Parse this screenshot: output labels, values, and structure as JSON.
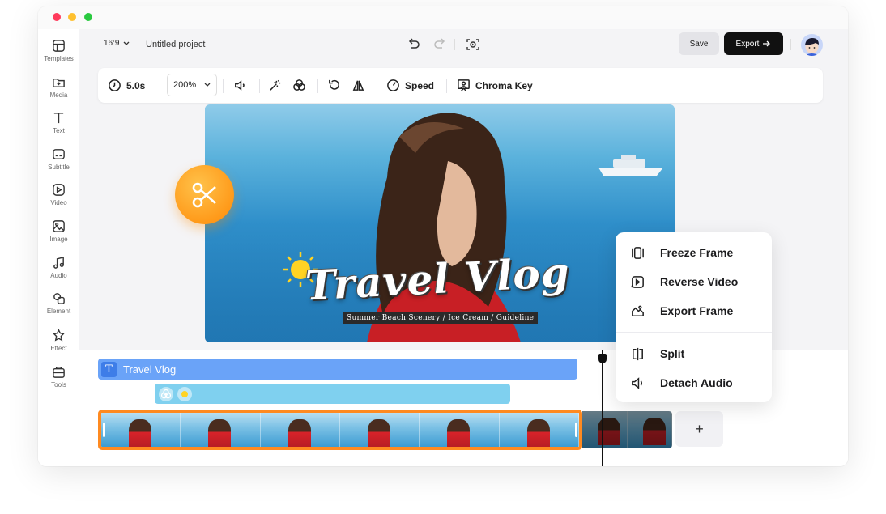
{
  "window": {
    "title": ""
  },
  "sidebar": {
    "items": [
      {
        "label": "Templates",
        "icon": "templates-icon"
      },
      {
        "label": "Media",
        "icon": "media-icon"
      },
      {
        "label": "Text",
        "icon": "text-icon"
      },
      {
        "label": "Subtitle",
        "icon": "subtitle-icon"
      },
      {
        "label": "Video",
        "icon": "video-icon"
      },
      {
        "label": "Image",
        "icon": "image-icon"
      },
      {
        "label": "Audio",
        "icon": "audio-icon"
      },
      {
        "label": "Element",
        "icon": "element-icon"
      },
      {
        "label": "Effect",
        "icon": "effect-icon"
      },
      {
        "label": "Tools",
        "icon": "tools-icon"
      }
    ]
  },
  "topbar": {
    "aspect_ratio": "16:9",
    "project_name": "Untitled project",
    "save_label": "Save",
    "export_label": "Export"
  },
  "toolbar": {
    "duration": "5.0s",
    "zoom": "200%",
    "speed_label": "Speed",
    "chroma_key_label": "Chroma Key"
  },
  "preview": {
    "title_overlay": "Travel Vlog",
    "subtitle_overlay": "Summer Beach Scenery / Ice Cream / Guideline"
  },
  "timeline": {
    "text_track_label": "Travel Vlog",
    "add_clip_label": "+"
  },
  "context_menu": {
    "items": [
      {
        "label": "Freeze Frame",
        "icon": "freeze-frame-icon"
      },
      {
        "label": "Reverse Video",
        "icon": "reverse-video-icon"
      },
      {
        "label": "Export Frame",
        "icon": "export-frame-icon"
      },
      {
        "label": "Split",
        "icon": "split-icon"
      },
      {
        "label": "Detach Audio",
        "icon": "detach-audio-icon"
      }
    ]
  },
  "colors": {
    "accent_orange": "#ff8a20",
    "text_track": "#6aa3f8",
    "fx_track": "#7fd0ef",
    "export_button": "#111111"
  }
}
